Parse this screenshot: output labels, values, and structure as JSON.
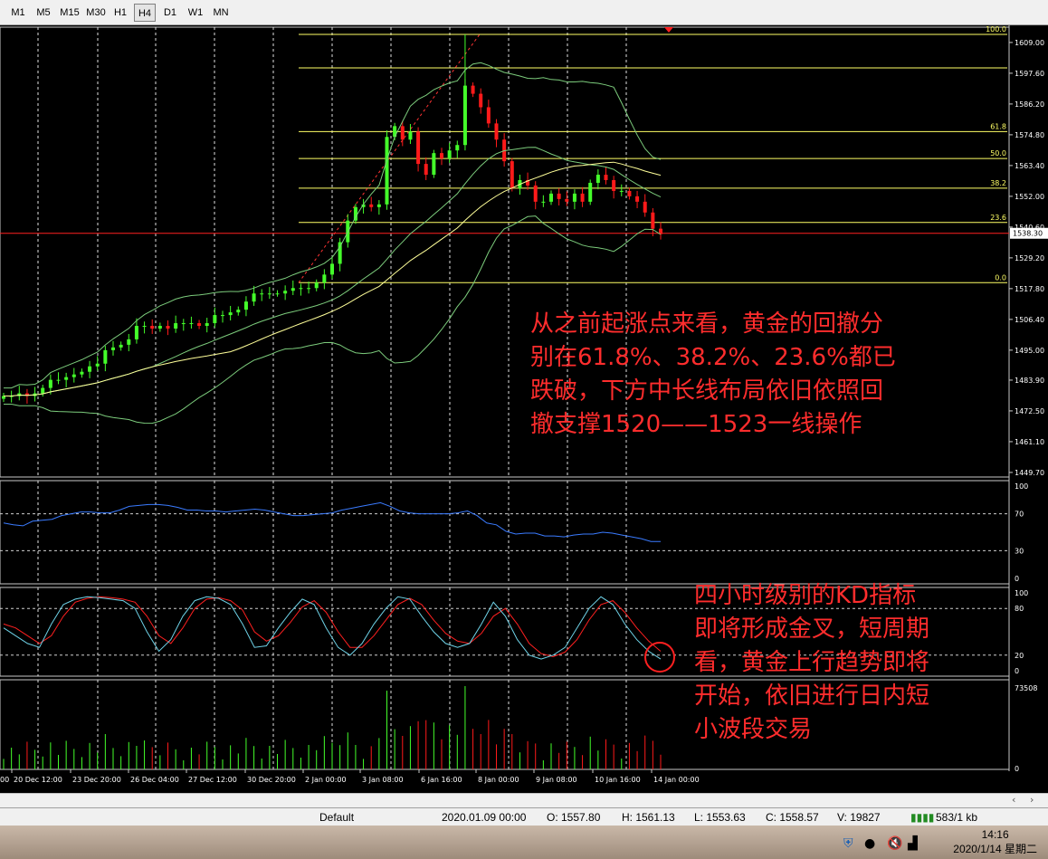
{
  "toolbar": {
    "timeframes": [
      "M1",
      "M5",
      "M15",
      "M30",
      "H1",
      "H4",
      "D1",
      "W1",
      "MN"
    ],
    "active": "H4"
  },
  "price_axis": [
    "1609.00",
    "1597.60",
    "1586.20",
    "1574.80",
    "1563.40",
    "1552.00",
    "1540.60",
    "1529.20",
    "1517.80",
    "1506.40",
    "1495.00",
    "1483.90",
    "1472.50",
    "1461.10",
    "1449.70"
  ],
  "current_price": "1538.30",
  "fib_levels": [
    {
      "label": "100.0",
      "price": 1612.0
    },
    {
      "label": "",
      "price": 1599.6
    },
    {
      "label": "61.8",
      "price": 1576.0
    },
    {
      "label": "50.0",
      "price": 1566.0
    },
    {
      "label": "38.2",
      "price": 1555.0
    },
    {
      "label": "23.6",
      "price": 1542.3
    },
    {
      "label": "0.0",
      "price": 1520.0
    }
  ],
  "rsi_axis": [
    "100",
    "70",
    "30",
    "0"
  ],
  "kd_axis": [
    "100",
    "80",
    "20",
    "0"
  ],
  "volume_axis": [
    "73508",
    "0"
  ],
  "time_axis": [
    "20 Dec 12:00",
    "23 Dec 20:00",
    "26 Dec 04:00",
    "27 Dec 12:00",
    "30 Dec 20:00",
    "2 Jan 00:00",
    "3 Jan 08:00",
    "6 Jan 16:00",
    "8 Jan 00:00",
    "9 Jan 08:00",
    "10 Jan 16:00",
    "14 Jan 00:00"
  ],
  "time_axis_partial": "00",
  "annotations": {
    "main": "从之前起涨点来看，黄金的回撤分\n别在61.8%、38.2%、23.6%都已\n跌破，下方中长线布局依旧依照回\n撤支撑1520——1523一线操作",
    "kd": "四小时级别的KD指标\n即将形成金叉，短周期\n看，黄金上行趋势即将\n开始，依旧进行日内短\n小波段交易"
  },
  "status": {
    "profile": "Default",
    "datetime": "2020.01.09 00:00",
    "open": "O: 1557.80",
    "high": "H: 1561.13",
    "low": "L: 1553.63",
    "close": "C: 1558.57",
    "volume": "V: 19827",
    "traffic": "583/1 kb"
  },
  "clock": {
    "time": "14:16",
    "date": "2020/1/14 星期二"
  },
  "colors": {
    "bull": "#44ff2a",
    "bear": "#ff1a1a",
    "fib": "#ffff66",
    "band": "#7ccc7c",
    "ma": "#ffff99",
    "rsi": "#3a7bff",
    "kd_main": "#6fd3e8",
    "kd_signal": "#ff2020",
    "annotation": "#ff2d2d"
  },
  "chart_data": {
    "type": "candlestick",
    "symbol_timeframe": "H4",
    "ohlc_close_approx": [
      1478,
      1478,
      1479,
      1478,
      1479,
      1481,
      1484,
      1484,
      1485,
      1486,
      1487,
      1489,
      1490,
      1495,
      1496,
      1497,
      1499,
      1504,
      1504,
      1503,
      1504,
      1503,
      1505,
      1505,
      1505,
      1504,
      1505,
      1508,
      1508,
      1509,
      1510,
      1513,
      1516,
      1516,
      1516,
      1516,
      1517,
      1518,
      1518,
      1518,
      1520,
      1523,
      1527,
      1535,
      1543,
      1548,
      1549,
      1548,
      1549,
      1574,
      1578,
      1573,
      1576,
      1564,
      1560,
      1568,
      1566,
      1569,
      1571,
      1593,
      1590,
      1585,
      1579,
      1573,
      1565,
      1555,
      1558,
      1556,
      1550,
      1550,
      1553,
      1551,
      1550,
      1553,
      1550,
      1557,
      1560,
      1558,
      1554,
      1554,
      1552,
      1550,
      1546,
      1540,
      1538
    ],
    "rsi_approx": [
      60,
      58,
      57,
      62,
      63,
      64,
      68,
      70,
      72,
      72,
      71,
      71,
      74,
      78,
      79,
      80,
      80,
      79,
      77,
      74,
      74,
      73,
      73,
      72,
      73,
      74,
      75,
      74,
      72,
      70,
      68,
      68,
      69,
      70,
      71,
      74,
      76,
      78,
      80,
      82,
      78,
      73,
      71,
      70,
      70,
      70,
      70,
      71,
      73,
      68,
      60,
      58,
      51,
      48,
      49,
      49,
      46,
      46,
      45,
      47,
      48,
      48,
      50,
      49,
      47,
      45,
      43,
      40,
      40
    ],
    "kd_main_approx": [
      55,
      45,
      35,
      30,
      60,
      85,
      92,
      95,
      94,
      92,
      90,
      80,
      50,
      25,
      40,
      70,
      90,
      95,
      93,
      85,
      60,
      30,
      32,
      55,
      75,
      92,
      85,
      55,
      30,
      20,
      35,
      60,
      80,
      95,
      92,
      70,
      50,
      35,
      30,
      35,
      60,
      88,
      70,
      40,
      20,
      15,
      20,
      30,
      55,
      80,
      95,
      85,
      60,
      40,
      25,
      15
    ],
    "kd_signal_approx": [
      60,
      55,
      45,
      35,
      45,
      70,
      88,
      93,
      95,
      94,
      92,
      88,
      70,
      45,
      35,
      55,
      80,
      92,
      94,
      90,
      78,
      50,
      38,
      45,
      62,
      82,
      90,
      75,
      50,
      30,
      30,
      45,
      65,
      85,
      93,
      85,
      65,
      48,
      38,
      35,
      48,
      70,
      80,
      60,
      35,
      22,
      18,
      24,
      40,
      65,
      85,
      90,
      75,
      55,
      38,
      25
    ]
  }
}
